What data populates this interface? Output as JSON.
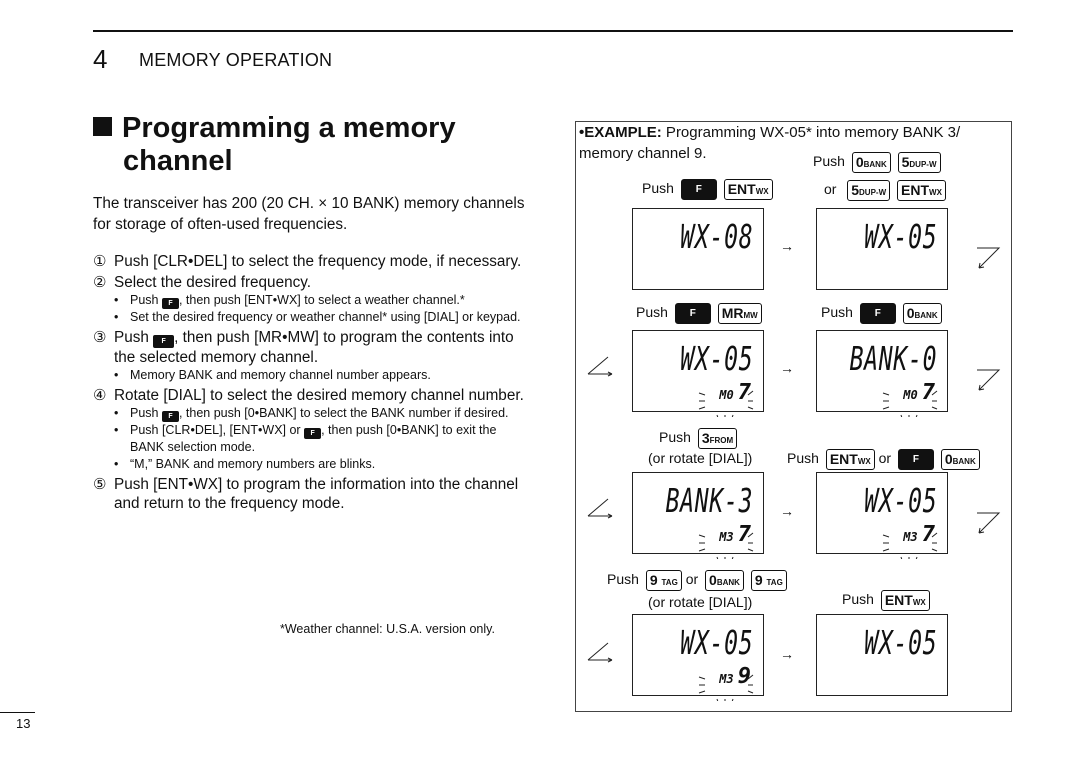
{
  "header": {
    "section_number": "4",
    "section_title": "MEMORY OPERATION"
  },
  "heading": {
    "line1": "Programming a memory",
    "line2": "channel"
  },
  "intro": "The transceiver has 200 (20 CH. × 10 BANK) memory channels for storage of often-used frequencies.",
  "steps": [
    {
      "num": "①",
      "text": "Push [CLR•DEL] to select the frequency mode, if necessary."
    },
    {
      "num": "②",
      "text": "Select the desired frequency.",
      "subs": [
        {
          "pre": "Push",
          "key": "F",
          "post": ", then push [ENT•WX] to select a weather channel.*"
        },
        {
          "text": "Set the desired frequency or weather channel* using [DIAL] or keypad."
        }
      ]
    },
    {
      "num": "③",
      "pre": "Push",
      "key": "F",
      "text": ", then push [MR•MW] to program the contents into the selected memory channel.",
      "subs": [
        {
          "text": "Memory BANK and memory channel number appears."
        }
      ]
    },
    {
      "num": "④",
      "text": "Rotate [DIAL] to select the desired memory channel number.",
      "subs": [
        {
          "pre": "Push",
          "key": "F",
          "post": ", then push [0•BANK] to select the BANK number if desired."
        },
        {
          "pre": "Push [CLR•DEL], [ENT•WX] or",
          "key": "F",
          "post": ", then push [0•BANK] to exit the BANK selection mode."
        },
        {
          "text": "“M,” BANK and memory numbers are blinks."
        }
      ]
    },
    {
      "num": "⑤",
      "text": "Push [ENT•WX] to program the information into the channel and return to the frequency mode."
    }
  ],
  "footnote": "*Weather channel: U.S.A. version only.",
  "page_number": "13",
  "example": {
    "label": "•EXAMPLE:",
    "text1": " Programming WX-05* into memory BANK 3/",
    "text2": "memory channel 9.",
    "push": "Push",
    "or": "or",
    "rotate": "(or rotate [DIAL])",
    "keys": {
      "f": "F",
      "ent": "ENT",
      "ent_sub": "WX",
      "bank0": "0",
      "bank0_sub": "BANK",
      "dup5": "5",
      "dup5_sub": "DUP-W",
      "mr": "MR",
      "mr_sub": "MW",
      "from3": "3",
      "from3_sub": "FROM",
      "tag9": "9",
      "tag9_sub": "TAG"
    },
    "displays": [
      {
        "main": "WX-08",
        "mem": "",
        "ch": ""
      },
      {
        "main": "WX-05",
        "mem": "",
        "ch": ""
      },
      {
        "main": "WX-05",
        "mem": "M0",
        "ch": "7"
      },
      {
        "main": "BANK-0",
        "mem": "M0",
        "ch": "7"
      },
      {
        "main": "BANK-3",
        "mem": "M3",
        "ch": "7"
      },
      {
        "main": "WX-05",
        "mem": "M3",
        "ch": "7"
      },
      {
        "main": "WX-05",
        "mem": "M3",
        "ch": "9"
      },
      {
        "main": "WX-05",
        "mem": "",
        "ch": ""
      }
    ]
  }
}
